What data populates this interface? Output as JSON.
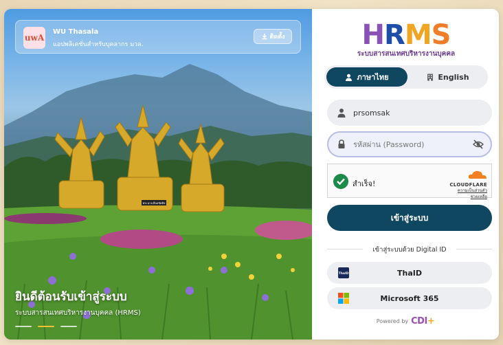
{
  "app_banner": {
    "name": "WU Thasala",
    "description": "แอปพลิเคชั่นสำหรับบุคลากร มวล.",
    "install_label": "ติดตั้ง",
    "logo_text": "uwA"
  },
  "hero": {
    "title": "ยินดีต้อนรับเข้าสู่ระบบ",
    "subtitle": "ระบบสารสนเทศบริหารงานบุคคล (HRMS)",
    "slides": 3,
    "active_slide": 1,
    "statue_sign": "พระนางเลือดขัตติย"
  },
  "logo": {
    "h": "H",
    "r": "R",
    "m": "M",
    "s": "S",
    "subtitle": "ระบบสารสนเทศบริหารงานบุคคล"
  },
  "language": {
    "thai_label": "ภาษาไทย",
    "english_label": "English",
    "selected": "thai"
  },
  "username": {
    "value": "prsomsak"
  },
  "password": {
    "placeholder": "รหัสผ่าน (Password)"
  },
  "captcha": {
    "status": "สำเร็จ!",
    "brand": "CLOUDFLARE",
    "privacy": "ความเป็นส่วนตัว",
    "help": "ช่วยเหลือ"
  },
  "login_label": "เข้าสู่ระบบ",
  "digital_id_label": "เข้าสู่ระบบด้วย Digital ID",
  "thaid": {
    "label": "ThaID",
    "icon_text": "ThaID"
  },
  "microsoft": {
    "label": "Microsoft 365"
  },
  "powered": {
    "text": "Powered by",
    "brand_a": "CDI",
    "brand_b": "+"
  },
  "colors": {
    "primary": "#0f4761",
    "accent": "#f2c033",
    "success": "#1c8a4a"
  }
}
